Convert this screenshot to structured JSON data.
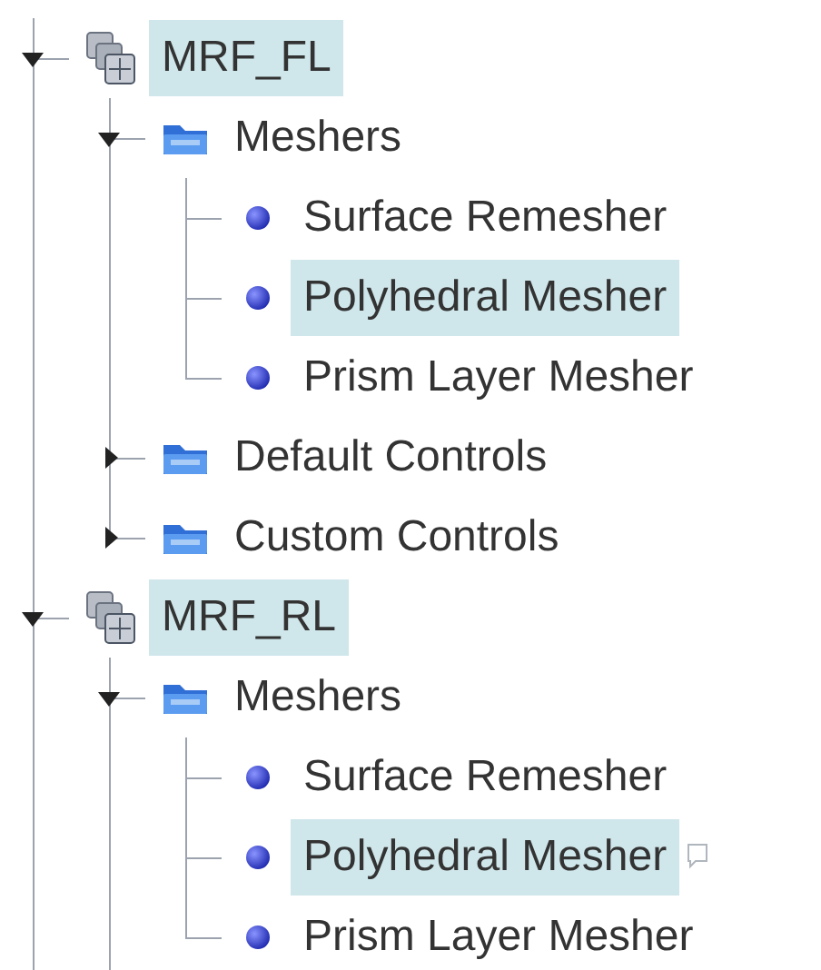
{
  "tree": [
    {
      "label": "MRF_FL",
      "kind": "region",
      "selected": true,
      "expanded": true,
      "children": [
        {
          "label": "Meshers",
          "kind": "folder",
          "selected": false,
          "expanded": true,
          "children": [
            {
              "label": "Surface Remesher",
              "kind": "mesher",
              "selected": false,
              "comment": false
            },
            {
              "label": "Polyhedral Mesher",
              "kind": "mesher",
              "selected": true,
              "comment": false
            },
            {
              "label": "Prism Layer Mesher",
              "kind": "mesher",
              "selected": false,
              "comment": false
            }
          ]
        },
        {
          "label": "Default Controls",
          "kind": "folder",
          "selected": false,
          "expanded": false
        },
        {
          "label": "Custom Controls",
          "kind": "folder",
          "selected": false,
          "expanded": false
        }
      ]
    },
    {
      "label": "MRF_RL",
      "kind": "region",
      "selected": true,
      "expanded": true,
      "children": [
        {
          "label": "Meshers",
          "kind": "folder",
          "selected": false,
          "expanded": true,
          "children": [
            {
              "label": "Surface Remesher",
              "kind": "mesher",
              "selected": false,
              "comment": false
            },
            {
              "label": "Polyhedral Mesher",
              "kind": "mesher",
              "selected": true,
              "comment": true
            },
            {
              "label": "Prism Layer Mesher",
              "kind": "mesher",
              "selected": false,
              "comment": false
            }
          ]
        }
      ]
    }
  ]
}
